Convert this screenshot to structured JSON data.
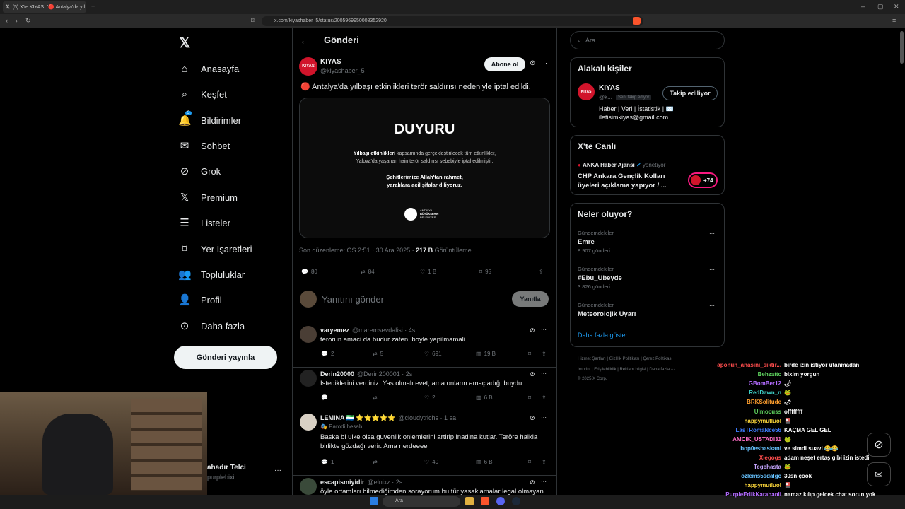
{
  "browser": {
    "tab_title": "(5) X'te KIYAS: \"🔴 Antalya'da yıl...",
    "url": "x.com/kiyashaber_5/status/2005969950008352920"
  },
  "nav": {
    "items": [
      {
        "label": "Anasayfa"
      },
      {
        "label": "Keşfet"
      },
      {
        "label": "Bildirimler",
        "badge": "5"
      },
      {
        "label": "Sohbet"
      },
      {
        "label": "Grok"
      },
      {
        "label": "Premium"
      },
      {
        "label": "Listeler"
      },
      {
        "label": "Yer İşaretleri"
      },
      {
        "label": "Topluluklar"
      },
      {
        "label": "Profil"
      },
      {
        "label": "Daha fazla"
      }
    ],
    "post_button": "Gönderi yayınla",
    "account_name": "ahadır Telci",
    "account_handle": "purplebixi"
  },
  "header": {
    "title": "Gönderi"
  },
  "post": {
    "author": "KIYAS",
    "handle": "@kiyashaber_5",
    "follow_button": "Abone ol",
    "text": "🔴 Antalya'da yılbaşı etkinlikleri terör saldırısı nedeniyle iptal edildi.",
    "avatar_text": "KIYAS",
    "image": {
      "heading": "DUYURU",
      "body_bold": "Yılbaşı etkinlikleri",
      "body1": " kapsamında gerçekleştirilecek tüm etkinlikler,",
      "body2": "Yalova'da yaşanan hain terör saldırısı sebebiyle iptal edilmiştir.",
      "bold_line1": "Şehitlerimize Allah'tan rahmet,",
      "bold_line2": "yaralılara acil şifalar diliyoruz.",
      "logo_line1": "ANTALYA",
      "logo_line2": "BÜYÜKŞEHİR",
      "logo_line3": "BELEDİYESİ"
    },
    "meta_prefix": "Son düzenleme: ÖS 2:51 · 30 Ara 2025 · ",
    "views": "217 B",
    "views_label": " Görüntüleme",
    "stats": {
      "replies": "80",
      "reposts": "84",
      "likes": "1 B",
      "bookmarks": "95"
    }
  },
  "reply_box": {
    "placeholder": "Yanıtını gönder",
    "button": "Yanıtla"
  },
  "replies": [
    {
      "name": "varyemez",
      "handle": "@maremsevdalisi · 4s",
      "text": "terorun amaci da budur zaten. boyle yapilmamali.",
      "replies": "2",
      "reposts": "5",
      "likes": "691",
      "views": "19 B"
    },
    {
      "name": "Derin20000",
      "handle": "@Derin200001 · 2s",
      "text": "İstediklerini verdiniz. Yas olmalı evet, ama onların amaçladığı buydu.",
      "replies": "",
      "reposts": "",
      "likes": "2",
      "views": "6 B"
    },
    {
      "name": "LEMINA 🇸🇱 ⭐⭐⭐⭐⭐",
      "handle": "@cloudytrichs · 1 sa",
      "parody": "🎭 Parodi hesabı",
      "text1": "Baska bi ulke olsa guvenlik onlemlerini artirip inadina kutlar. Teröre halkla",
      "text2": "birlikte gözdağı verir. Ama nerdeeee",
      "replies": "1",
      "reposts": "",
      "likes": "40",
      "views": "6 B"
    },
    {
      "name": "escapismiyidir",
      "handle": "@elnixz · 2s",
      "text": "öyle ortamları bilmediğimden sorayorum bu tür yasaklamalar legal olmayan"
    }
  ],
  "search": {
    "placeholder": "Ara"
  },
  "related": {
    "title": "Alakalı kişiler",
    "name": "KIYAS",
    "handle": "@k...",
    "follows_you": "Seni takip ediyor",
    "button": "Takip ediliyor",
    "bio1": "Haber | Veri | İstatistik | ✉️",
    "bio2": "iletisimkiyas@gmail.com"
  },
  "live": {
    "title": "X'te Canlı",
    "host": "ANKA Haber Ajansı",
    "host_suffix": " yönetiyor",
    "text1": "CHP Ankara Gençlik Kolları",
    "text2": "üyeleri açıklama yapıyor / ...",
    "count": "+74"
  },
  "trends": {
    "title": "Neler oluyor?",
    "items": [
      {
        "category": "Gündemdekiler",
        "name": "Emre",
        "count": "8.907 gönderi"
      },
      {
        "category": "Gündemdekiler",
        "name": "#Ebu_Ubeyde",
        "count": "3.826 gönderi"
      },
      {
        "category": "Gündemdekiler",
        "name": "Meteorolojik Uyarı",
        "count": ""
      }
    ],
    "show_more": "Daha fazla göster"
  },
  "footer": {
    "row1": "Hizmet Şartları  |  Gizlilik Politikası  |  Çerez Politikası",
    "row2": "Imprint  |  Erişilebilirlik  |  Reklam bilgisi  |  Daha fazla ···",
    "copyright": "© 2025 X Corp."
  },
  "chat": [
    {
      "user": "aponun_anasini_siktir...",
      "msg": "birde izin istiyor utanmadan",
      "color": "#ff4d4d"
    },
    {
      "user": "Behzattc",
      "msg": "bixim yorgun",
      "color": "#5fd35f"
    },
    {
      "user": "GBomBer12",
      "msg": "🌶",
      "color": "#b36bff"
    },
    {
      "user": "RedDawn_n",
      "msg": "🐸",
      "color": "#3fd1c8"
    },
    {
      "user": "BRKSolitude",
      "msg": "🌶",
      "color": "#ff9f2e"
    },
    {
      "user": "Ulmocuss",
      "msg": "offffffff",
      "color": "#5fd35f"
    },
    {
      "user": "happymutluol",
      "msg": "🎴",
      "color": "#ffd93b"
    },
    {
      "user": "LasTRomaNce56",
      "msg": "KAÇMA GEL GEL",
      "color": "#3f7dff"
    },
    {
      "user": "AMCIK_USTADI31",
      "msg": "🐸",
      "color": "#ff6ec7"
    },
    {
      "user": "bop0esbaskani",
      "msg": "ve simdi suavi 😂😂",
      "color": "#66c2ff"
    },
    {
      "user": "Xiegogs",
      "msg": "adam neşet ertaş gibi izin istedi",
      "color": "#ff4d4d"
    },
    {
      "user": "Tegehasta",
      "msg": "🐸",
      "color": "#c7a6ff"
    },
    {
      "user": "ozlems5sdalgc",
      "msg": "30sn çook",
      "color": "#66c2ff"
    },
    {
      "user": "happymutluol",
      "msg": "🎴",
      "color": "#ffd93b"
    },
    {
      "user": "PurpleErlikKarahanli",
      "msg": "namaz kılıp gelcek chat sorun yok",
      "color": "#b36bff"
    }
  ],
  "taskbar": {
    "search": "Ara"
  },
  "colors": {
    "accent": "#1d9bf0",
    "bg": "#000000",
    "border": "#2f3336",
    "muted": "#71767b",
    "brand_red": "#d1142b"
  }
}
